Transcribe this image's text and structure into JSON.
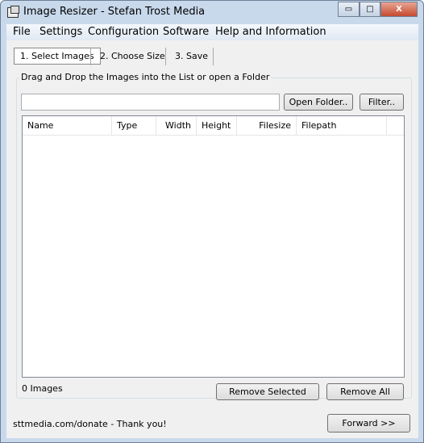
{
  "window": {
    "title": "Image Resizer - Stefan Trost Media",
    "minimize": "▭",
    "maximize": "□",
    "close": "X"
  },
  "menu": [
    "File",
    "Settings",
    "Configuration",
    "Software",
    "Help and Information"
  ],
  "tabs": [
    "1. Select Images",
    "2. Choose Size",
    "3. Save"
  ],
  "group": {
    "label": "Drag and Drop the Images into the List or open a Folder",
    "path_value": "",
    "open_folder": "Open Folder..",
    "filter": "Filter.."
  },
  "columns": [
    "Name",
    "Type",
    "Width",
    "Height",
    "Filesize",
    "Filepath"
  ],
  "rows": [],
  "footer": {
    "count": "0 Images",
    "remove_selected": "Remove Selected",
    "remove_all": "Remove All",
    "donate": "sttmedia.com/donate - Thank you!",
    "forward": "Forward >>"
  }
}
